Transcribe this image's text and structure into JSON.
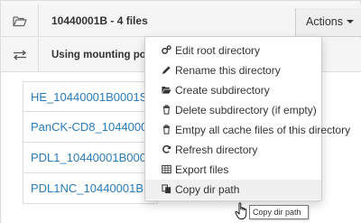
{
  "header": {
    "title": "10440001B - 4 files",
    "actions_label": "Actions",
    "mount_text": "Using mounting point"
  },
  "files": [
    "HE_10440001B0001S",
    "PanCK-CD8_1044000",
    "PDL1_10440001B000",
    "PDL1NC_10440001B"
  ],
  "menu": {
    "items": [
      {
        "label": "Edit root directory",
        "icon": "gears-icon"
      },
      {
        "label": "Rename this directory",
        "icon": "pencil-icon"
      },
      {
        "label": "Create subdirectory",
        "icon": "folder-open-icon"
      },
      {
        "label": "Delete subdirectory (if empty)",
        "icon": "trash-icon"
      },
      {
        "label": "Emtpy all cache files of this directory",
        "icon": "trash-icon"
      },
      {
        "label": "Refresh directory",
        "icon": "refresh-icon"
      },
      {
        "label": "Export files",
        "icon": "table-icon"
      },
      {
        "label": "Copy dir path",
        "icon": "copy-icon"
      }
    ]
  },
  "tooltip": "Copy dir path",
  "colors": {
    "link": "#2a7ab8",
    "menu_hover": "#f0f0f0"
  }
}
